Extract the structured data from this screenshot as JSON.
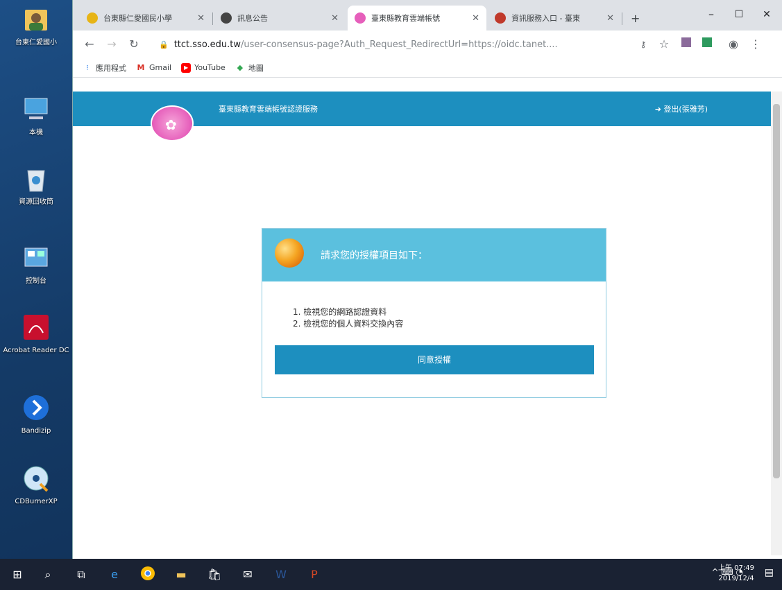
{
  "desktop": {
    "icons": [
      {
        "label": "台東仁愛國小",
        "name": "user-folder"
      },
      {
        "label": "本機",
        "name": "this-pc"
      },
      {
        "label": "資源回收筒",
        "name": "recycle-bin"
      },
      {
        "label": "控制台",
        "name": "control-panel"
      },
      {
        "label": "Acrobat Reader DC",
        "name": "acrobat-reader"
      },
      {
        "label": "Bandizip",
        "name": "bandizip"
      },
      {
        "label": "CDBurnerXP",
        "name": "cdburnerxp"
      }
    ]
  },
  "browser": {
    "tabs": [
      {
        "title": "台東縣仁愛國民小學",
        "active": false,
        "favcolor": "#e7b416"
      },
      {
        "title": "訊息公告",
        "active": false,
        "favcolor": "#444444"
      },
      {
        "title": "臺東縣教育雲端帳號",
        "active": true,
        "favcolor": "#e65fbb"
      },
      {
        "title": "資訊服務入口 - 臺東",
        "active": false,
        "favcolor": "#c0392b"
      }
    ],
    "new_tab": "+",
    "window_controls": {
      "minimize": "–",
      "maximize": "☐",
      "close": "✕"
    },
    "url_host": "ttct.sso.edu.tw",
    "url_path": "/user-consensus-page?Auth_Request_RedirectUrl=https://oidc.tanet....",
    "bookmarks": [
      {
        "label": "應用程式",
        "icon": "apps-icon"
      },
      {
        "label": "Gmail",
        "icon": "gmail-icon"
      },
      {
        "label": "YouTube",
        "icon": "youtube-icon"
      },
      {
        "label": "地圖",
        "icon": "maps-icon"
      }
    ]
  },
  "page": {
    "brand": "臺東縣教育雲端帳號認證服務",
    "logout": "登出(張雅芳)",
    "card_title": "請求您的授權項目如下：",
    "items": [
      "1. 檢視您的網路認證資料",
      "2. 檢視您的個人資料交換內容"
    ],
    "agree_button": "同意授權"
  },
  "taskbar": {
    "time": "上午 07:49",
    "date": "2019/12/4"
  },
  "colors": {
    "topbar": "#1d8fbf",
    "card_header": "#5bc0de",
    "logo": "#e65fbb"
  }
}
